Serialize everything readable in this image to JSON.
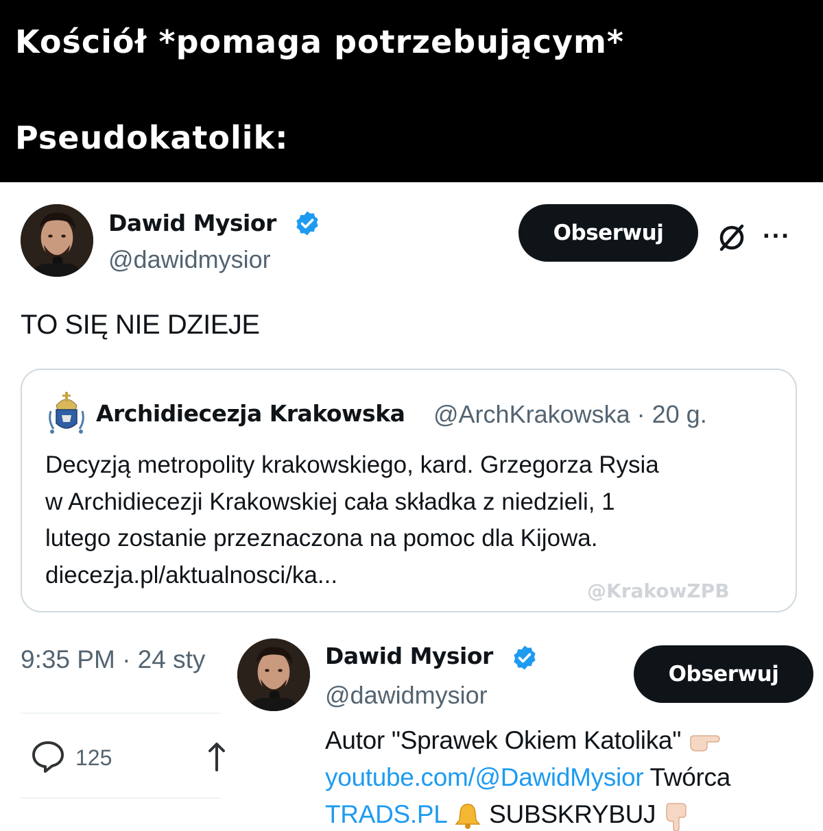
{
  "caption": {
    "line1": "Kościół *pomaga potrzebującym*",
    "line2": "Pseudokatolik:"
  },
  "tweet": {
    "author": {
      "name": "Dawid Mysior",
      "handle": "@dawidmysior",
      "verified": true
    },
    "follow_label": "Obserwuj",
    "grok_icon": "grok-icon",
    "more_icon": "more-icon",
    "text": "TO SIĘ NIE DZIEJE",
    "quote": {
      "name": "Archidiecezja Krakowska",
      "meta": "@ArchKrakowska · 20 g.",
      "lines": [
        "Decyzją metropolity krakowskiego, kard. Grzegorza Rysia",
        "w Archidiecezji Krakowskiej cała składka z niedzieli, 1",
        "lutego zostanie przeznaczona na pomoc dla Kijowa.",
        "diecezja.pl/aktualnosci/ka..."
      ]
    },
    "watermark": "@KrakowZPB",
    "timestamp": "9:35 PM · 24 sty",
    "replies": "125"
  },
  "hover_card": {
    "name": "Dawid Mysior",
    "handle": "@dawidmysior",
    "follow_label": "Obserwuj",
    "bio_line1": "Autor \"Sprawek Okiem Katolika\"",
    "bio_link1": "youtube.com/@DawidMysior",
    "bio_after_link1": " Twórca",
    "bio_link2": "TRADS.PL",
    "bio_after_link2": "SUBSKRYBUJ"
  },
  "colors": {
    "caption_bg": "#000000",
    "verified": "#1d9bf0",
    "link": "#1d9bf0",
    "button_bg": "#0f1419",
    "secondary_text": "#536471"
  }
}
